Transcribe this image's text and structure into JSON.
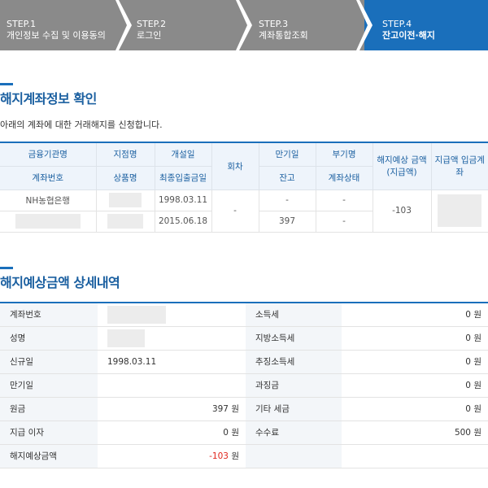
{
  "steps": [
    {
      "num": "STEP.1",
      "label": "개인정보 수집 및 이용동의"
    },
    {
      "num": "STEP.2",
      "label": "로그인"
    },
    {
      "num": "STEP.3",
      "label": "계좌통합조회"
    },
    {
      "num": "STEP.4",
      "label": "잔고이전·해지"
    }
  ],
  "colors": {
    "active_step": "#1a6fbb",
    "inactive_step": "#8a8a8a",
    "negative": "#e0261c"
  },
  "section1": {
    "title": "해지계좌정보 확인",
    "description": "아래의 계좌에 대한 거래해지를 신청합니다."
  },
  "table1": {
    "headers_row1": [
      "금융기관명",
      "지점명",
      "개설일",
      "회차",
      "만기일",
      "부기명",
      "해지예상 금액 (지급액)",
      "지급액 입금계좌"
    ],
    "headers_row2": [
      "계좌번호",
      "상품명",
      "최종입출금일",
      "잔고",
      "계좌상태"
    ],
    "row1": {
      "institution": "NH농협은행",
      "open_date": "1998.03.11",
      "round": "-",
      "maturity": "-",
      "sub_name": "-",
      "expected_amount": "-103"
    },
    "row2": {
      "last_txn": "2015.06.18",
      "balance": "397",
      "status": "-"
    }
  },
  "section2": {
    "title": "해지예상금액 상세내역"
  },
  "table2": {
    "unit": "원",
    "left": [
      {
        "label": "계좌번호",
        "value": ""
      },
      {
        "label": "성명",
        "value": ""
      },
      {
        "label": "신규일",
        "value": "1998.03.11"
      },
      {
        "label": "만기일",
        "value": ""
      },
      {
        "label": "원금",
        "value": "397"
      },
      {
        "label": "지급 이자",
        "value": "0"
      },
      {
        "label": "해지예상금액",
        "value": "-103"
      }
    ],
    "right": [
      {
        "label": "소득세",
        "value": "0"
      },
      {
        "label": "지방소득세",
        "value": "0"
      },
      {
        "label": "추징소득세",
        "value": "0"
      },
      {
        "label": "과징금",
        "value": "0"
      },
      {
        "label": "기타 세금",
        "value": "0"
      },
      {
        "label": "수수료",
        "value": "500"
      }
    ]
  }
}
